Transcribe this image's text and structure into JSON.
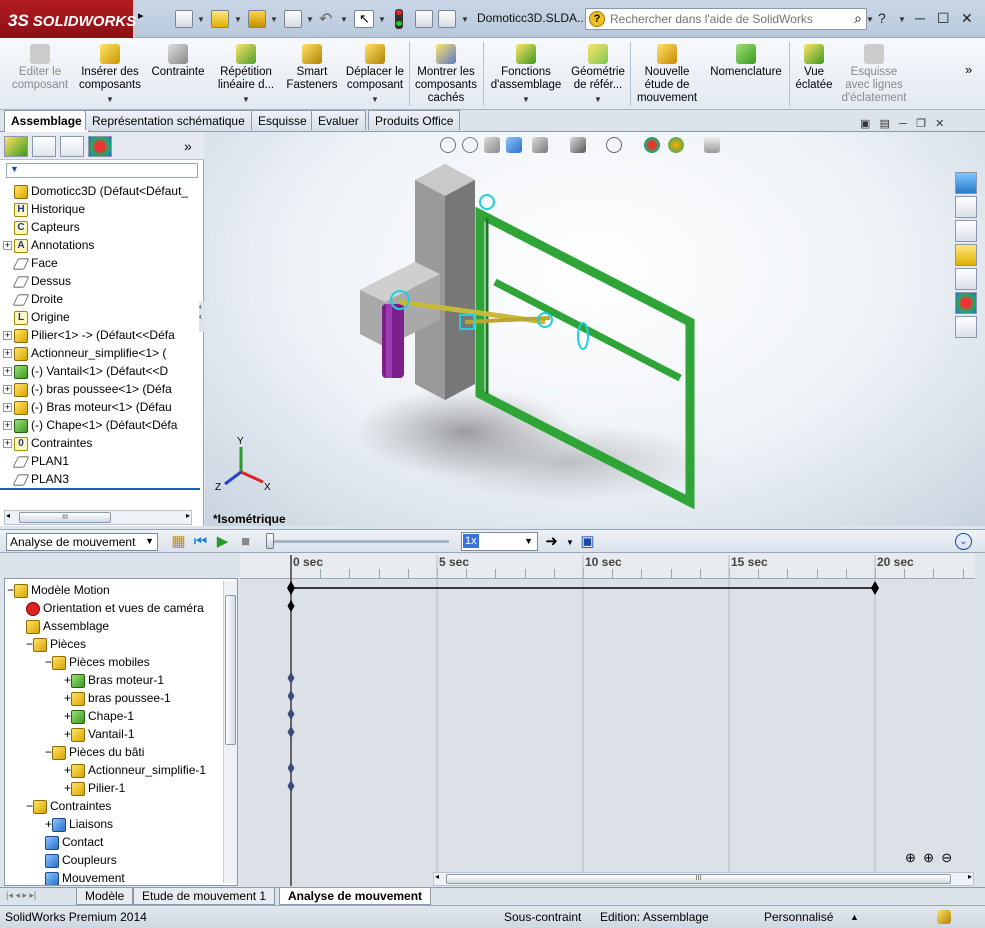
{
  "app": {
    "brand": "SOLIDWORKS",
    "brand_prefix": "3S",
    "document_title": "Domoticc3D.SLDA...",
    "help_placeholder": "Rechercher dans l'aide de SolidWorks"
  },
  "command_manager": {
    "items": [
      {
        "label": "Editer le\ncomposant",
        "disabled": true
      },
      {
        "label": "Insérer des\ncomposants"
      },
      {
        "label": "Contrainte"
      },
      {
        "label": "Répétition\nlinéaire d..."
      },
      {
        "label": "Smart\nFasteners"
      },
      {
        "label": "Déplacer le\ncomposant"
      },
      {
        "label": "Montrer les\ncomposants\ncachés"
      },
      {
        "label": "Fonctions\nd'assemblage"
      },
      {
        "label": "Géométrie\nde référ..."
      },
      {
        "label": "Nouvelle\nétude de\nmouvement"
      },
      {
        "label": "Nomenclature"
      },
      {
        "label": "Vue\néclatée"
      },
      {
        "label": "Esquisse\navec lignes\nd'éclatement",
        "disabled": true
      }
    ],
    "tabs": [
      "Assemblage",
      "Représentation schématique",
      "Esquisse",
      "Evaluer",
      "Produits Office"
    ]
  },
  "feature_tree": {
    "filter_symbol": "▼",
    "items": [
      {
        "label": "Domoticc3D  (Défaut<Défaut_",
        "icon": "yellow",
        "expand": "none"
      },
      {
        "label": "Historique",
        "icon": "letter",
        "glyph": "H",
        "expand": "none"
      },
      {
        "label": "Capteurs",
        "icon": "letter",
        "glyph": "C",
        "expand": "none"
      },
      {
        "label": "Annotations",
        "icon": "letter",
        "glyph": "A",
        "expand": "plus"
      },
      {
        "label": "Face",
        "icon": "plane",
        "expand": "none"
      },
      {
        "label": "Dessus",
        "icon": "plane",
        "expand": "none"
      },
      {
        "label": "Droite",
        "icon": "plane",
        "expand": "none"
      },
      {
        "label": "Origine",
        "icon": "letter",
        "glyph": "L",
        "expand": "none"
      },
      {
        "label": "Pilier<1> -> (Défaut<<Défa",
        "icon": "yellow",
        "expand": "plus"
      },
      {
        "label": "Actionneur_simplifie<1> (",
        "icon": "yellow",
        "expand": "plus"
      },
      {
        "label": "(-) Vantail<1> (Défaut<<D",
        "icon": "green",
        "expand": "plus"
      },
      {
        "label": "(-) bras poussee<1> (Défa",
        "icon": "yellow",
        "expand": "plus"
      },
      {
        "label": "(-) Bras moteur<1> (Défau",
        "icon": "yellow",
        "expand": "plus"
      },
      {
        "label": "(-) Chape<1> (Défaut<Défa",
        "icon": "green",
        "expand": "plus"
      },
      {
        "label": "Contraintes",
        "icon": "letter",
        "glyph": "0",
        "expand": "plus"
      },
      {
        "label": "PLAN1",
        "icon": "plane",
        "expand": "none"
      },
      {
        "label": "PLAN3",
        "icon": "plane",
        "expand": "none"
      }
    ],
    "scroll_thumb": "III"
  },
  "viewport": {
    "view_label": "*Isométrique",
    "triad": {
      "x": "X",
      "y": "Y",
      "z": "Z"
    }
  },
  "motion_toolbar": {
    "study_type": "Analyse de mouvement",
    "speed": "1x"
  },
  "timeline": {
    "ticks": [
      "0 sec",
      "5 sec",
      "10 sec",
      "15 sec",
      "20 sec"
    ],
    "tick_values": [
      0,
      5,
      10,
      15,
      20
    ],
    "end_value": 20,
    "keyframe_rows": [
      0,
      1,
      5,
      6,
      7,
      8,
      10,
      11
    ],
    "key_start": 0
  },
  "motion_tree": {
    "items": [
      {
        "label": "Modèle Motion",
        "indent": 0,
        "icon": "yellow",
        "expand": "minus"
      },
      {
        "label": "Orientation et vues de caméra",
        "indent": 1,
        "icon": "red",
        "expand": "none"
      },
      {
        "label": "Assemblage",
        "indent": 1,
        "icon": "yellow",
        "expand": "none"
      },
      {
        "label": "Pièces",
        "indent": 1,
        "icon": "yellow",
        "expand": "minus"
      },
      {
        "label": "Pièces mobiles",
        "indent": 2,
        "icon": "yellow",
        "expand": "minus"
      },
      {
        "label": "Bras moteur-1",
        "indent": 3,
        "icon": "green",
        "expand": "plus"
      },
      {
        "label": "bras poussee-1",
        "indent": 3,
        "icon": "yellow",
        "expand": "plus"
      },
      {
        "label": "Chape-1",
        "indent": 3,
        "icon": "green",
        "expand": "plus"
      },
      {
        "label": "Vantail-1",
        "indent": 3,
        "icon": "yellow",
        "expand": "plus"
      },
      {
        "label": "Pièces du bâti",
        "indent": 2,
        "icon": "yellow",
        "expand": "minus"
      },
      {
        "label": "Actionneur_simplifie-1",
        "indent": 3,
        "icon": "yellow",
        "expand": "plus"
      },
      {
        "label": "Pilier-1",
        "indent": 3,
        "icon": "yellow",
        "expand": "plus"
      },
      {
        "label": "Contraintes",
        "indent": 1,
        "icon": "yellow",
        "expand": "minus"
      },
      {
        "label": "Liaisons",
        "indent": 2,
        "icon": "blue",
        "expand": "plus"
      },
      {
        "label": "Contact",
        "indent": 2,
        "icon": "blue",
        "expand": "none"
      },
      {
        "label": "Coupleurs",
        "indent": 2,
        "icon": "blue",
        "expand": "none"
      },
      {
        "label": "Mouvement",
        "indent": 2,
        "icon": "blue",
        "expand": "none"
      }
    ]
  },
  "bottom_tabs": [
    "Modèle",
    "Etude de mouvement 1",
    "Analyse de mouvement"
  ],
  "hscroll_thumb": "III",
  "status_bar": {
    "product": "SolidWorks Premium 2014",
    "constraint": "Sous-contraint",
    "edition": "Edition: Assemblage",
    "units": "Personnalisé",
    "caret": "▲"
  }
}
